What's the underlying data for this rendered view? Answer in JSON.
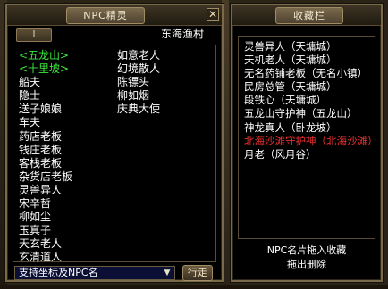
{
  "npc_panel": {
    "title": "NPC精灵",
    "tab_label": "I",
    "close_glyph": "✕",
    "location": "东海渔村",
    "list_col1": [
      {
        "label": "<五龙山>",
        "color": "green"
      },
      {
        "label": "<十里坡>",
        "color": "green"
      },
      {
        "label": "船夫"
      },
      {
        "label": "隐士"
      },
      {
        "label": "送子娘娘"
      },
      {
        "label": "车夫"
      },
      {
        "label": "药店老板"
      },
      {
        "label": "钱庄老板"
      },
      {
        "label": "客栈老板"
      },
      {
        "label": "杂货店老板"
      },
      {
        "label": "灵兽异人"
      },
      {
        "label": "宋辛哲"
      },
      {
        "label": "柳如尘"
      },
      {
        "label": "玉真子"
      },
      {
        "label": "天玄老人"
      },
      {
        "label": "玄清道人"
      }
    ],
    "list_col2": [
      {
        "label": "如意老人"
      },
      {
        "label": "幻境散人"
      },
      {
        "label": "陈镖头"
      },
      {
        "label": "柳如烟"
      },
      {
        "label": "庆典大使"
      }
    ],
    "search": {
      "value": "支持坐标及NPC名",
      "dropdown_icon": "chevron-down-icon"
    },
    "go_label": "行走",
    "colors": {
      "green": "#3fe83f",
      "red": "#e83030",
      "search_bg": "#0b0f35"
    }
  },
  "fav_panel": {
    "title": "收藏栏",
    "items": [
      {
        "label": "灵兽异人（天墉城）"
      },
      {
        "label": "天机老人（天墉城）"
      },
      {
        "label": "无名药铺老板（无名小镇）"
      },
      {
        "label": "民房总管（天墉城）"
      },
      {
        "label": "段铁心（天墉城）"
      },
      {
        "label": "五龙山守护神（五龙山）"
      },
      {
        "label": "神龙真人（卧龙坡）"
      },
      {
        "label": "北海沙滩守护神（北海沙滩）",
        "color": "red"
      },
      {
        "label": "月老（风月谷）"
      }
    ],
    "hint_line1": "NPC名片拖入收藏",
    "hint_line2": "拖出删除"
  }
}
